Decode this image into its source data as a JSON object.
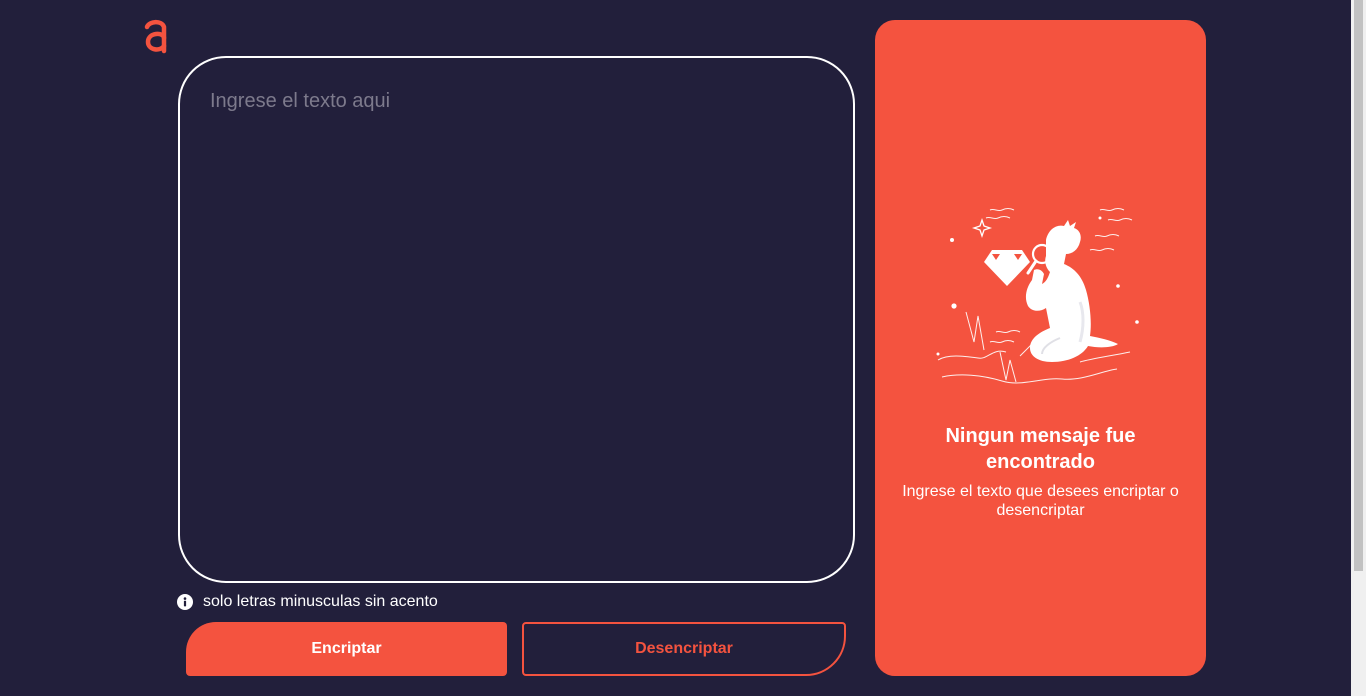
{
  "input": {
    "placeholder": "Ingrese el texto aqui",
    "value": ""
  },
  "hint": {
    "icon": "info-icon",
    "text": "solo letras minusculas sin acento"
  },
  "buttons": {
    "encrypt_label": "Encriptar",
    "decrypt_label": "Desencriptar"
  },
  "output": {
    "illustration": "person-inspecting-diamond-illustration",
    "title": "Ningun mensaje fue encontrado",
    "subtitle": "Ingrese el texto que desees encriptar o desencriptar"
  },
  "colors": {
    "background": "#221f3b",
    "accent": "#f4533f",
    "text": "#ffffff",
    "placeholder": "#7d7a8c"
  }
}
